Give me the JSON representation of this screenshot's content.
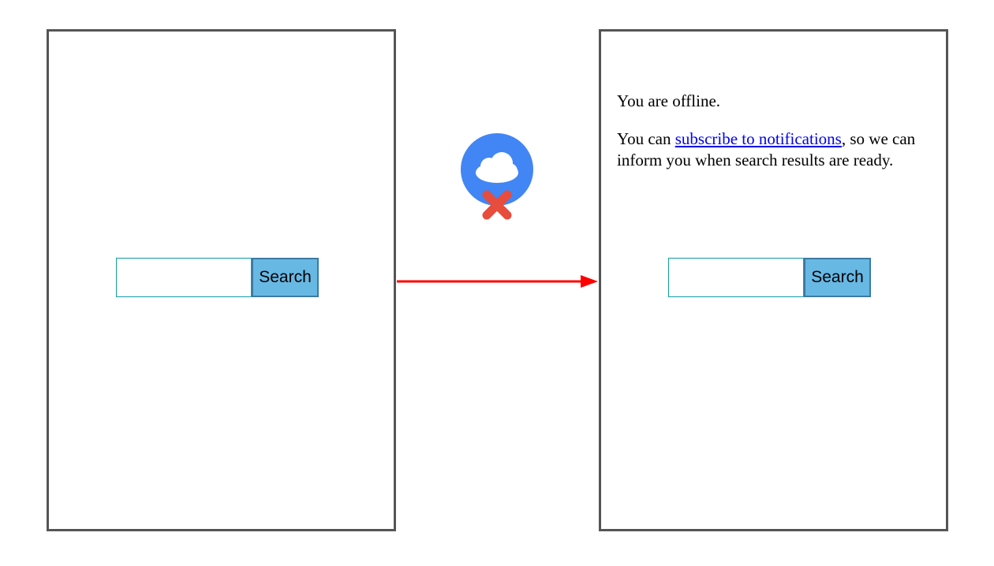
{
  "left_panel": {
    "search_button_label": "Search"
  },
  "right_panel": {
    "search_button_label": "Search",
    "offline_title": "You are offline.",
    "offline_prefix": "You can ",
    "offline_link": "subscribe to notifications",
    "offline_suffix": ", so we can inform you when search results are ready."
  },
  "icons": {
    "cloud": "cloud-offline-icon",
    "cross": "x-icon",
    "arrow": "arrow-right"
  },
  "colors": {
    "panel_border": "#555555",
    "input_border": "#119da4",
    "button_bg": "#68b8e4",
    "button_border": "#3b7aa3",
    "badge_bg": "#4285f4",
    "cross": "#e74c3c",
    "arrow": "#ff0000",
    "link": "#0000ee"
  }
}
